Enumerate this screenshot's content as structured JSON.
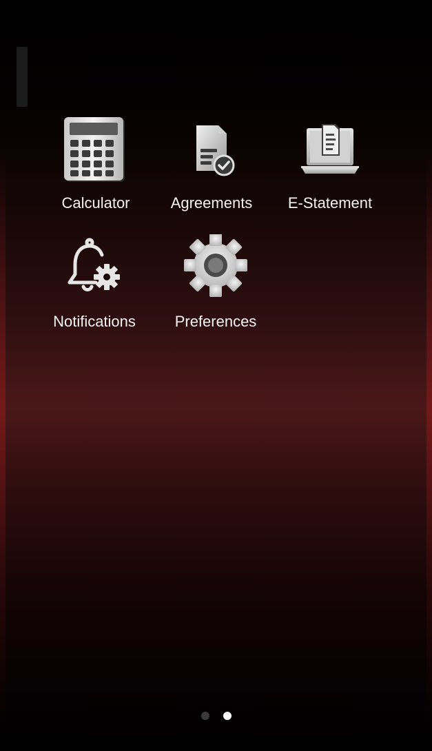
{
  "home_screen": {
    "apps": [
      {
        "label": "Calculator",
        "icon": "calculator-icon"
      },
      {
        "label": "Agreements",
        "icon": "agreement-document-icon"
      },
      {
        "label": "E-Statement",
        "icon": "laptop-document-icon"
      },
      {
        "label": "Notifications",
        "icon": "bell-gear-icon"
      },
      {
        "label": "Preferences",
        "icon": "gear-icon"
      }
    ],
    "pager": {
      "page_count": 2,
      "current_page": 2
    },
    "colors": {
      "background_top": "#000000",
      "background_mid": "#4a1718",
      "label_text": "#f2f2f2",
      "icon_fill": "#d9d9d9",
      "dot_active": "#ffffff",
      "dot_inactive": "#3a3a3a"
    }
  }
}
